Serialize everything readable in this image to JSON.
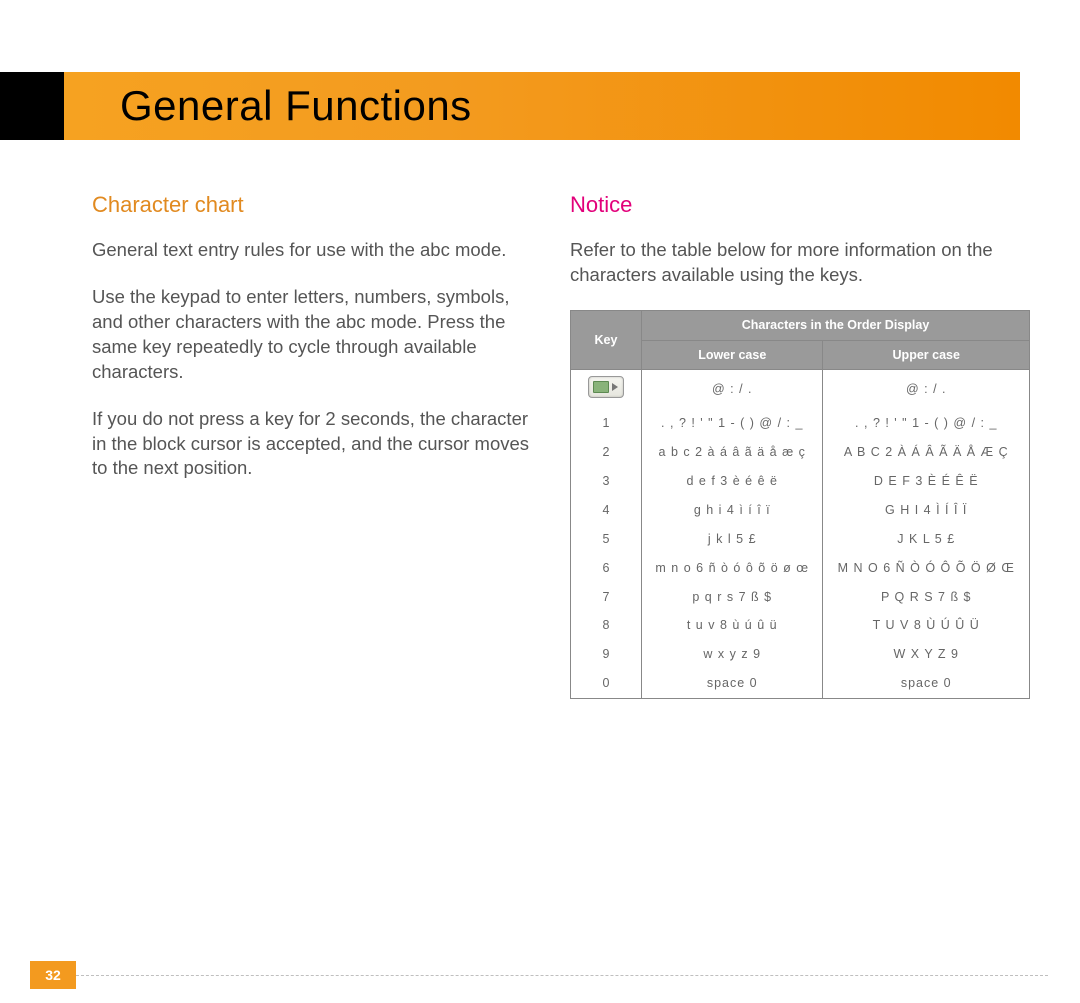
{
  "header": {
    "title": "General Functions"
  },
  "left": {
    "heading": "Character chart",
    "p1": "General text entry rules for use with the abc mode.",
    "p2": "Use the keypad to enter letters, numbers, symbols, and other characters with the abc mode. Press the same key repeatedly to cycle through available characters.",
    "p3": "If you do not press a key for 2 seconds, the character in the block cursor is accepted, and the cursor moves to the next position."
  },
  "right": {
    "notice_label": "Notice",
    "notice_text": "Refer to the table below for more information on the characters available using the keys."
  },
  "table": {
    "h_key": "Key",
    "h_span": "Characters in the Order Display",
    "h_lower": "Lower case",
    "h_upper": "Upper case",
    "rows": [
      {
        "key_icon": true,
        "lower": "@ : / .",
        "upper": "@ : / ."
      },
      {
        "key": "1",
        "lower": ". , ? ! ' \" 1 - ( ) @ / : _",
        "upper": ". , ? ! ' \" 1 - ( ) @ / : _"
      },
      {
        "key": "2",
        "lower": "a b c 2 à á â ã ä å æ ç",
        "upper": "A B C 2 À Á Â Ã Ä Å Æ Ç"
      },
      {
        "key": "3",
        "lower": "d e f 3 è é ê ë",
        "upper": "D E F 3 È É Ê Ë"
      },
      {
        "key": "4",
        "lower": "g h i 4 ì í î ï",
        "upper": "G H I 4 Ì Í Î Ï"
      },
      {
        "key": "5",
        "lower": "j k l 5 £",
        "upper": "J K L 5 £"
      },
      {
        "key": "6",
        "lower": "m n o 6 ñ ò ó ô õ ö ø œ",
        "upper": "M N O 6 Ñ Ò Ó Ô Õ Ö Ø Œ"
      },
      {
        "key": "7",
        "lower": "p q r s 7 ß $",
        "upper": "P Q R S 7 ß $"
      },
      {
        "key": "8",
        "lower": "t u v 8 ù ú û ü",
        "upper": "T U V 8 Ù Ú Û Ü"
      },
      {
        "key": "9",
        "lower": "w x y z 9",
        "upper": "W X Y Z 9"
      },
      {
        "key": "0",
        "lower": "space 0",
        "upper": "space 0"
      }
    ]
  },
  "footer": {
    "page_number": "32"
  }
}
